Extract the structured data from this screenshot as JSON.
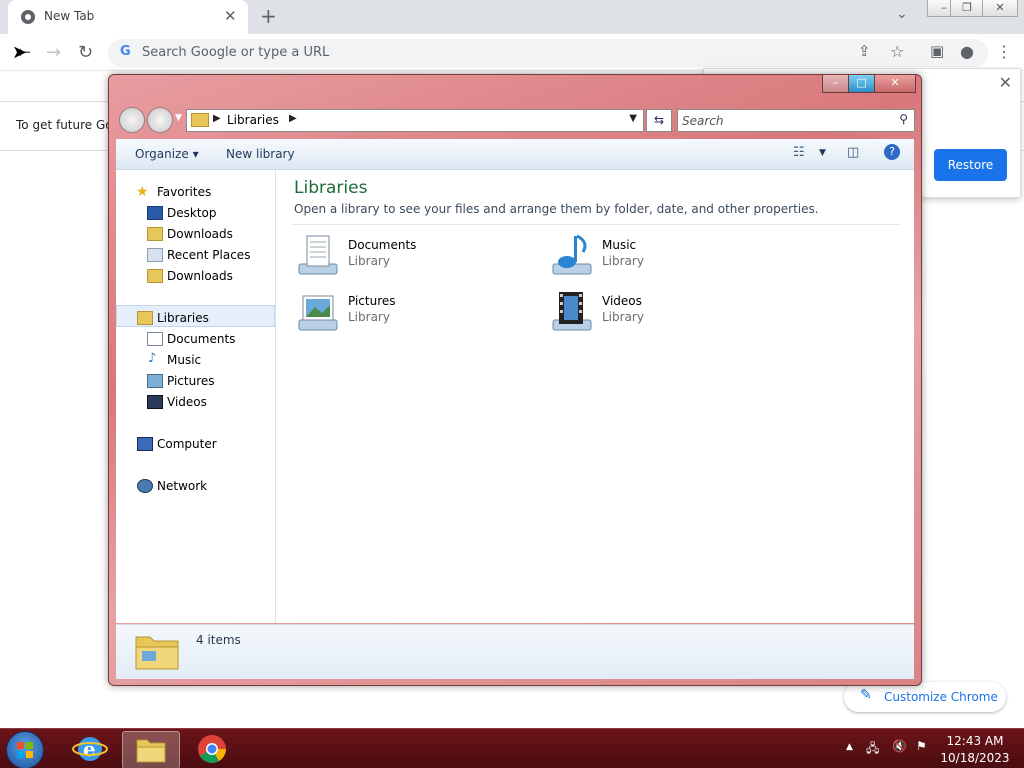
{
  "chrome": {
    "tab_title": "New Tab",
    "tab_close_glyph": "✕",
    "new_tab_glyph": "+",
    "omnibox_placeholder": "Search Google or type a URL",
    "omnibox_logo": "G",
    "infobar_text": "To get future Go",
    "restore_button": "Restore",
    "restore_close_glyph": "✕",
    "customize_button": "Customize Chrome",
    "window_controls": [
      "–",
      "❐",
      "✕"
    ]
  },
  "explorer": {
    "address_crumb": "Libraries",
    "search_placeholder": "Search",
    "commands": {
      "organize": "Organize ▾",
      "new_library": "New library"
    },
    "caption_buttons": [
      "–",
      "□",
      "✕"
    ],
    "nav": {
      "favorites_header": "Favorites",
      "favorites": [
        "Desktop",
        "Downloads",
        "Recent Places",
        "Downloads"
      ],
      "libraries_header": "Libraries",
      "libraries": [
        "Documents",
        "Music",
        "Pictures",
        "Videos"
      ],
      "computer": "Computer",
      "network": "Network"
    },
    "main": {
      "title": "Libraries",
      "subtitle": "Open a library to see your files and arrange them by folder, date, and other properties.",
      "items": [
        {
          "name": "Documents",
          "type": "Library",
          "icon": "documents-library-icon"
        },
        {
          "name": "Music",
          "type": "Library",
          "icon": "music-library-icon"
        },
        {
          "name": "Pictures",
          "type": "Library",
          "icon": "pictures-library-icon"
        },
        {
          "name": "Videos",
          "type": "Library",
          "icon": "videos-library-icon"
        }
      ]
    },
    "status": "4 items"
  },
  "taskbar": {
    "time": "12:43 AM",
    "date": "10/18/2023",
    "tray_expand_glyph": "▲"
  },
  "colors": {
    "aero_frame": "#d8787c",
    "taskbar": "#5a1014",
    "chrome_blue": "#1a73e8",
    "libraries_title": "#1e6a3a"
  }
}
